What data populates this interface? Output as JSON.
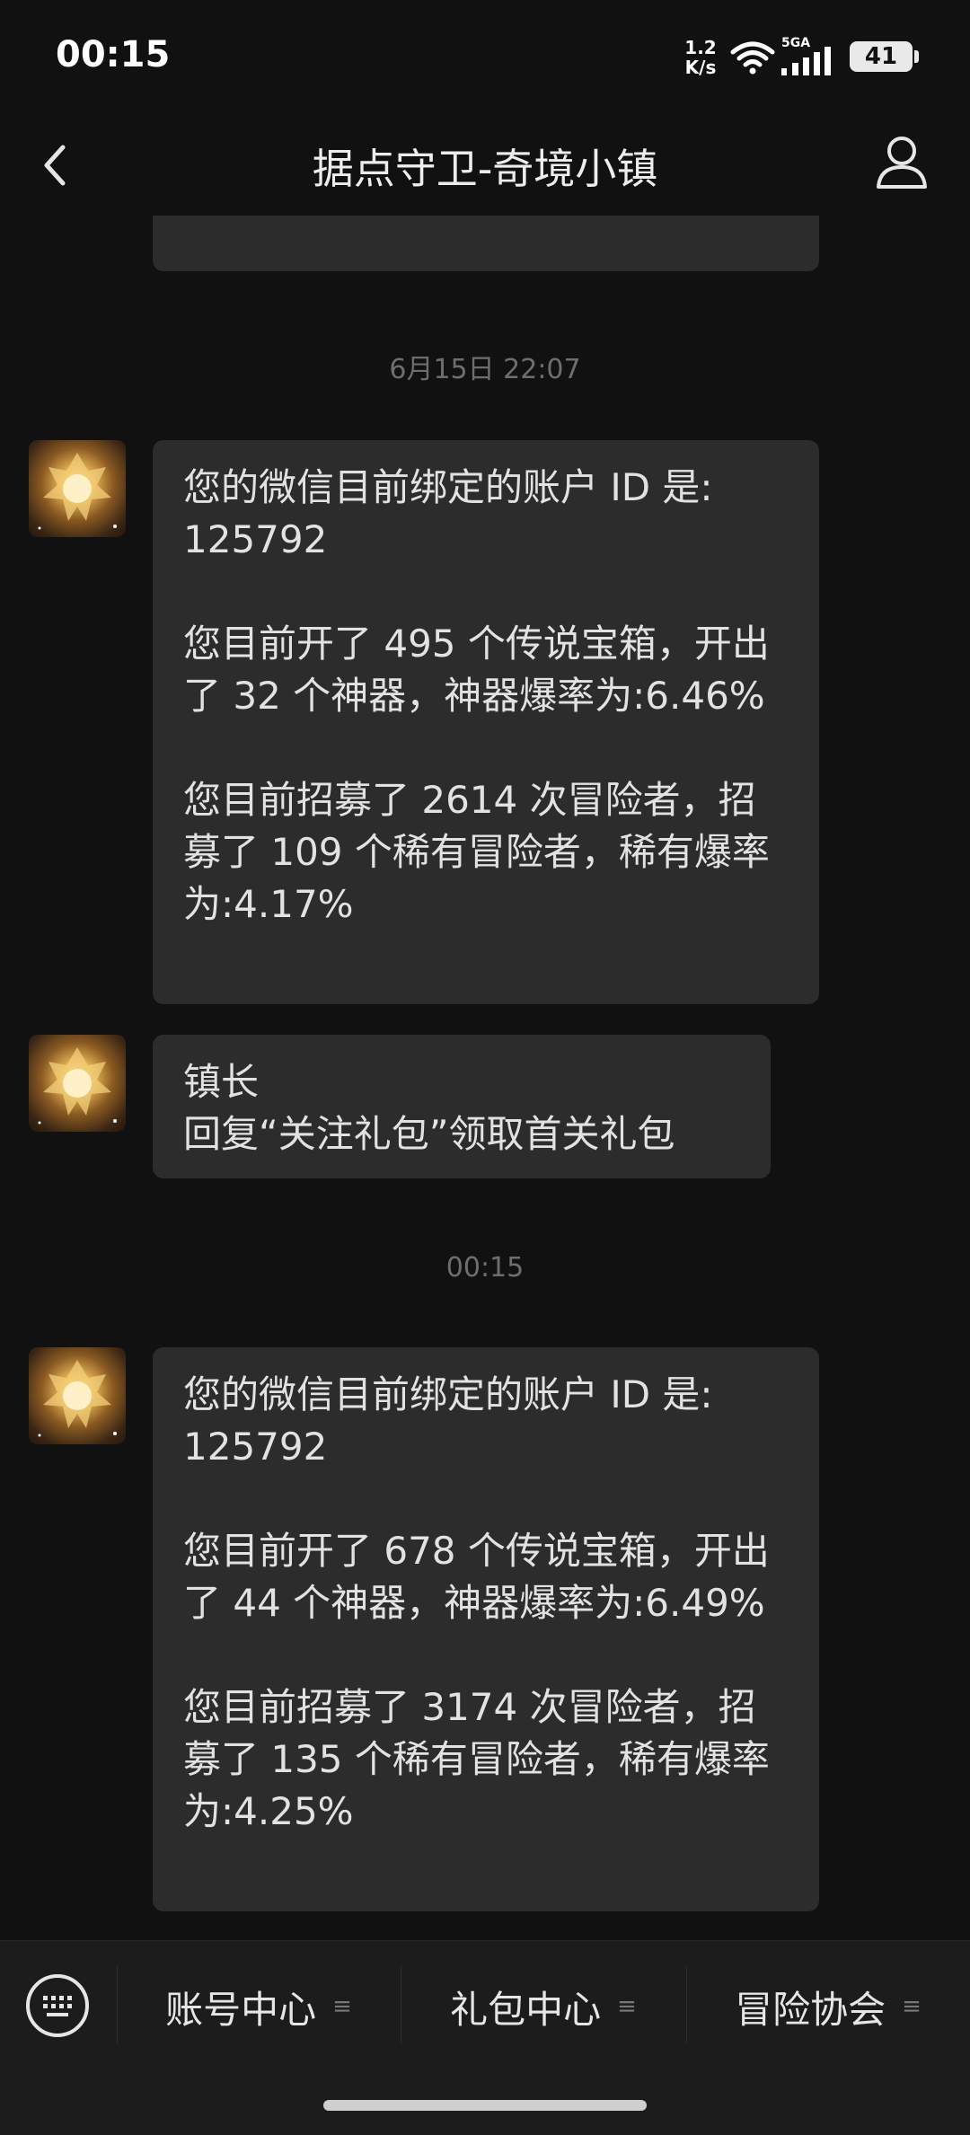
{
  "status_bar": {
    "time": "00:15",
    "net_speed_value": "1.2",
    "net_speed_unit": "K/s",
    "signal_label": "5GA",
    "battery": "41"
  },
  "header": {
    "title": "据点守卫-奇境小镇"
  },
  "chat": {
    "timestamps": [
      "6月15日 22:07",
      "00:15"
    ],
    "messages": [
      "您的微信目前绑定的账户 ID 是:\n125792\n\n您目前开了 495 个传说宝箱，开出了 32 个神器，神器爆率为:6.46%\n\n您目前招募了 2614 次冒险者，招募了 109 个稀有冒险者，稀有爆率为:4.17%",
      "镇长\n回复“关注礼包”领取首关礼包",
      "您的微信目前绑定的账户 ID 是:\n125792\n\n您目前开了 678 个传说宝箱，开出了 44 个神器，神器爆率为:6.49%\n\n您目前招募了 3174 次冒险者，招募了 135 个稀有冒险者，稀有爆率为:4.25%"
    ]
  },
  "bottom_menu": {
    "items": [
      "账号中心",
      "礼包中心",
      "冒险协会"
    ],
    "menu_glyph": "≡"
  },
  "colors": {
    "background": "#111111",
    "bubble": "#2c2c2c",
    "text": "#e2e2e2",
    "timestamp": "#6e6e6e"
  }
}
